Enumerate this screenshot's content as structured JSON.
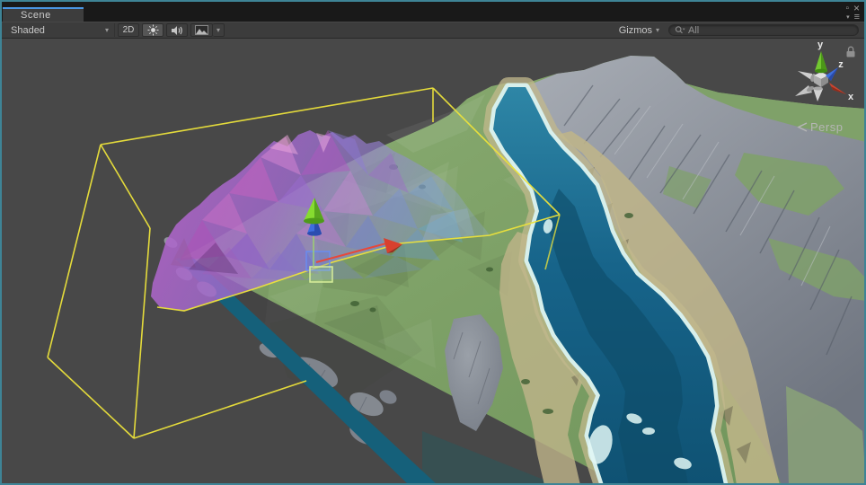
{
  "window": {
    "tab_label": "Scene",
    "controls": {
      "maximize_glyph": "▫",
      "close_glyph": "×",
      "dropdown_glyph": "▾",
      "menu_glyph": "≡"
    }
  },
  "toolbar": {
    "shading_mode": "Shaded",
    "mode_2d_label": "2D",
    "gizmos_label": "Gizmos",
    "search_value": "All"
  },
  "viewport": {
    "projection_label": "Persp",
    "axis_labels": {
      "x": "x",
      "y": "y",
      "z": "z"
    }
  },
  "icons": [
    "dropdown-icon",
    "sun-icon",
    "audio-icon",
    "image-icon",
    "search-icon",
    "maximize-icon",
    "close-icon",
    "menu-icon",
    "lock-icon",
    "axis-gizmo",
    "move-tool-gizmo",
    "persp-chevron-icon"
  ],
  "colors": {
    "tab_highlight": "#4A96E3",
    "window_border": "#3E8496",
    "titlebar_bg": "#191919",
    "panel_bg": "#3C3C3C",
    "viewport_bg": "#484848",
    "wireframe_yellow": "#EDE33B",
    "selection_purple": "#A866C4",
    "terrain_green": "#7E9F68",
    "water_blue": "#166384",
    "sand_tan": "#C2B88C",
    "rock_gray": "#8A8F98",
    "axis_x_red": "#C8402C",
    "axis_y_green": "#6EC32B",
    "axis_z_blue": "#3E6EDC"
  }
}
